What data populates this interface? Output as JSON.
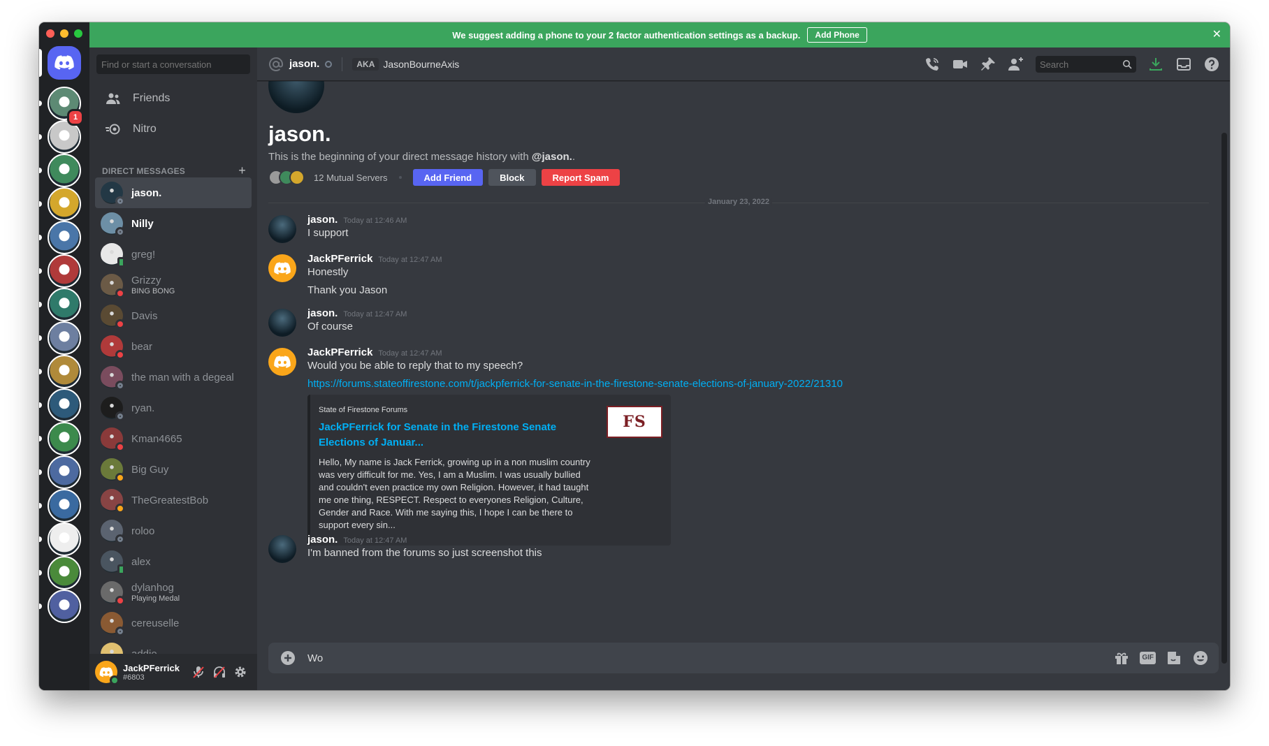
{
  "colors": {
    "accent": "#5865f2",
    "notice_green": "#3ba55d",
    "danger": "#ed4245",
    "link": "#00aff4",
    "online": "#3ba55d",
    "dnd": "#ed4245",
    "offline": "#747f8d",
    "idle": "#faa61a"
  },
  "notice": {
    "text": "We suggest adding a phone to your 2 factor authentication settings as a backup.",
    "button": "Add Phone",
    "close": "✕"
  },
  "servers": {
    "mention_count": "1",
    "icons": [
      "server-icon",
      "server-icon",
      "server-icon",
      "server-icon",
      "server-icon",
      "server-icon",
      "server-icon",
      "server-icon",
      "server-icon",
      "server-icon",
      "server-icon",
      "server-icon",
      "server-icon",
      "server-icon",
      "server-icon",
      "server-icon"
    ]
  },
  "sidebar": {
    "search_placeholder": "Find or start a conversation",
    "nav": [
      {
        "label": "Friends",
        "icon": "friends-icon"
      },
      {
        "label": "Nitro",
        "icon": "nitro-icon"
      }
    ],
    "dm_header": "DIRECT MESSAGES",
    "dm_add": "+",
    "dms": [
      {
        "name": "jason.",
        "status": "offline",
        "active": true,
        "bright": true,
        "avatar": "#233845"
      },
      {
        "name": "Nilly",
        "status": "offline",
        "bright": true,
        "avatar": "#6d8fa6"
      },
      {
        "name": "greg!",
        "status": "mobile",
        "avatar": "#e8e8e8"
      },
      {
        "name": "Grizzy",
        "sub": "BING BONG",
        "status": "dnd",
        "avatar": "#6b5a46"
      },
      {
        "name": "Davis",
        "status": "dnd",
        "avatar": "#5a4a33"
      },
      {
        "name": "bear",
        "status": "dnd",
        "avatar": "#b03a3a"
      },
      {
        "name": "the man with a degeal",
        "status": "offline",
        "avatar": "#7a4c5e"
      },
      {
        "name": "ryan.",
        "status": "offline",
        "avatar": "#1d1d1d"
      },
      {
        "name": "Kman4665",
        "status": "dnd",
        "avatar": "#8a3a3a"
      },
      {
        "name": "Big Guy",
        "status": "idle",
        "avatar": "#6b7a3a"
      },
      {
        "name": "TheGreatestBob",
        "status": "idle",
        "avatar": "#884444"
      },
      {
        "name": "roloo",
        "status": "offline",
        "avatar": "#5b6370"
      },
      {
        "name": "alex",
        "status": "mobile",
        "avatar": "#4a5560"
      },
      {
        "name": "dylanhog",
        "sub": "Playing Medal",
        "status": "dnd",
        "avatar": "#6a6a6a"
      },
      {
        "name": "cereuselle",
        "status": "offline",
        "avatar": "#8a5a33"
      },
      {
        "name": "addie",
        "status": "offline",
        "avatar": "#e0c070"
      }
    ],
    "user": {
      "name": "JackPFerrick",
      "tag": "#6803"
    }
  },
  "header": {
    "name": "jason.",
    "aka_label": "AKA",
    "aka_name": "JasonBourneAxis",
    "search_placeholder": "Search"
  },
  "intro": {
    "name": "jason.",
    "text_prefix": "This is the beginning of your direct message history with ",
    "text_handle": "@jason.",
    "text_suffix": ".",
    "mutual": "12 Mutual Servers",
    "add_friend": "Add Friend",
    "block": "Block",
    "report": "Report Spam"
  },
  "date_divider": "January 23, 2022",
  "messages": [
    {
      "author": "jason.",
      "time": "Today at 12:46 AM",
      "lines": [
        "I support"
      ]
    },
    {
      "author": "JackPFerrick",
      "time": "Today at 12:47 AM",
      "lines": [
        "Honestly",
        "Thank you Jason"
      ]
    },
    {
      "author": "jason.",
      "time": "Today at 12:47 AM",
      "lines": [
        "Of course"
      ]
    },
    {
      "author": "JackPFerrick",
      "time": "Today at 12:47 AM",
      "lines": [
        "Would you be able to reply that to my speech?"
      ],
      "link": "https://forums.stateoffirestone.com/t/jackpferrick-for-senate-in-the-firestone-senate-elections-of-january-2022/21310"
    },
    {
      "author": "jason.",
      "time": "Today at 12:47 AM",
      "lines": [
        "I'm banned from the forums so just screenshot this"
      ]
    }
  ],
  "embed": {
    "provider": "State of Firestone Forums",
    "title": "JackPFerrick for Senate in the Firestone Senate Elections of Januar...",
    "description": "Hello, My name is Jack Ferrick, growing up in a non muslim country was very difficult for me. Yes, I am a Muslim. I was usually bullied and couldn't even practice my own Religion. However, it had taught me one thing, RESPECT. Respect to everyones Religion, Culture, Gender and Race. With me saying this, I hope I can be there to support every sin...",
    "thumb_text": "FS"
  },
  "composer": {
    "value": "Wo",
    "gif": "GIF"
  }
}
